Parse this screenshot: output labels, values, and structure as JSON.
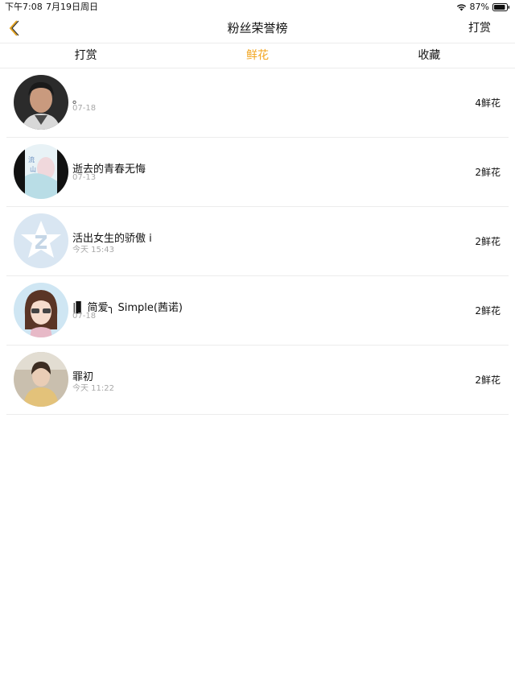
{
  "status_bar": {
    "time": "下午7:08",
    "date": "7月19日周日",
    "battery": "87%"
  },
  "nav": {
    "title": "粉丝荣誉榜",
    "right_label": "打赏"
  },
  "tabs": [
    {
      "label": "打赏",
      "active": false
    },
    {
      "label": "鲜花",
      "active": true
    },
    {
      "label": "收藏",
      "active": false
    }
  ],
  "colors": {
    "accent": "#f2a51f",
    "divider": "#ececec",
    "secondary_text": "#a8a8a8"
  },
  "fans": [
    {
      "name": "。",
      "time": "07-18",
      "count": "4鲜花"
    },
    {
      "name": "逝去的青春无悔",
      "time": "07-13",
      "count": "2鲜花"
    },
    {
      "name": "活出女生的骄傲 i",
      "time": "今天 15:43",
      "count": "2鲜花"
    },
    {
      "name": "|▋ 简爱╮ Simple(茜诺)",
      "time": "07-18",
      "count": "2鲜花"
    },
    {
      "name": "罪初",
      "time": "今天 11:22",
      "count": "2鲜花"
    }
  ]
}
